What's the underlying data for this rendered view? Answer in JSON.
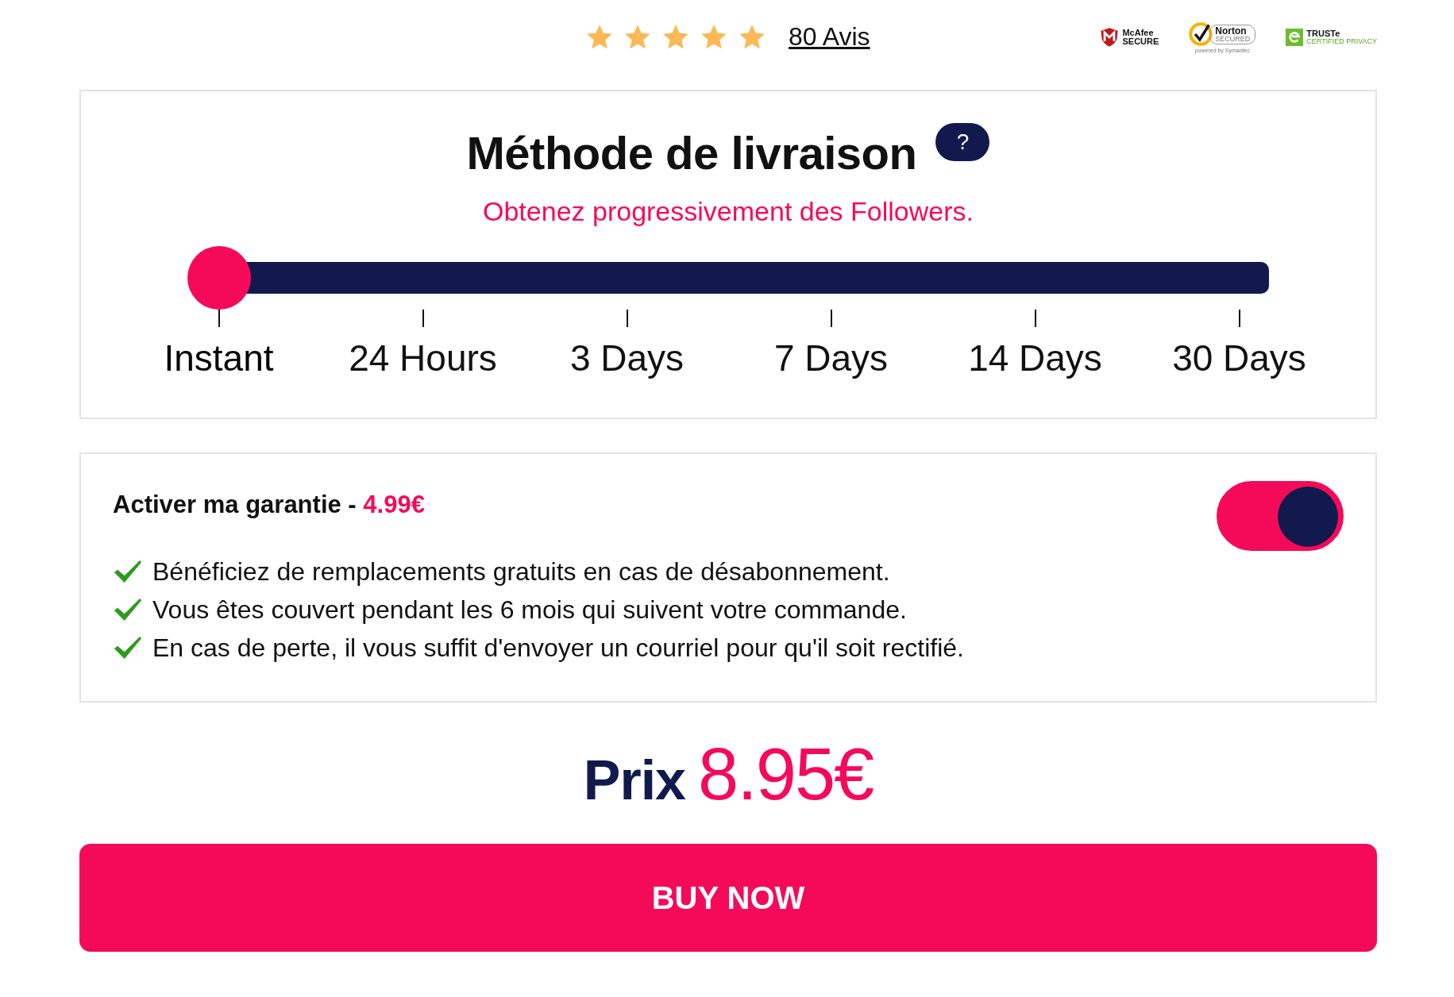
{
  "rating": {
    "stars": 5,
    "reviews_link": "80 Avis"
  },
  "badges": [
    {
      "kind": "mcafee",
      "lines": [
        "McAfee",
        "SECURE"
      ]
    },
    {
      "kind": "norton",
      "lines": [
        "Norton",
        "SECURED",
        "powered by Symantec"
      ]
    },
    {
      "kind": "truste",
      "lines": [
        "TRUSTe",
        "CERTIFIED PRIVACY"
      ]
    }
  ],
  "delivery": {
    "title": "Méthode de livraison",
    "help": "?",
    "subtitle": "Obtenez progressivement des Followers.",
    "options": [
      {
        "label": "Instant",
        "selected": true
      },
      {
        "label": "24 Hours",
        "selected": false
      },
      {
        "label": "3 Days",
        "selected": false
      },
      {
        "label": "7 Days",
        "selected": false
      },
      {
        "label": "14 Days",
        "selected": false
      },
      {
        "label": "30 Days",
        "selected": false
      }
    ]
  },
  "guarantee": {
    "title": "Activer ma garantie - **4.99€**",
    "on": true,
    "benefits": [
      "Bénéficiez de remplacements gratuits en cas de désabonnement.",
      "Vous êtes couvert pendant les 6 mois qui suivent votre commande.",
      "En cas de perte, il vous suffit d'envoyer un courriel pour qu'il soit rectifié."
    ]
  },
  "price": {
    "label": "Prix",
    "amount": "8.95€"
  },
  "buy_button": "BUY NOW"
}
